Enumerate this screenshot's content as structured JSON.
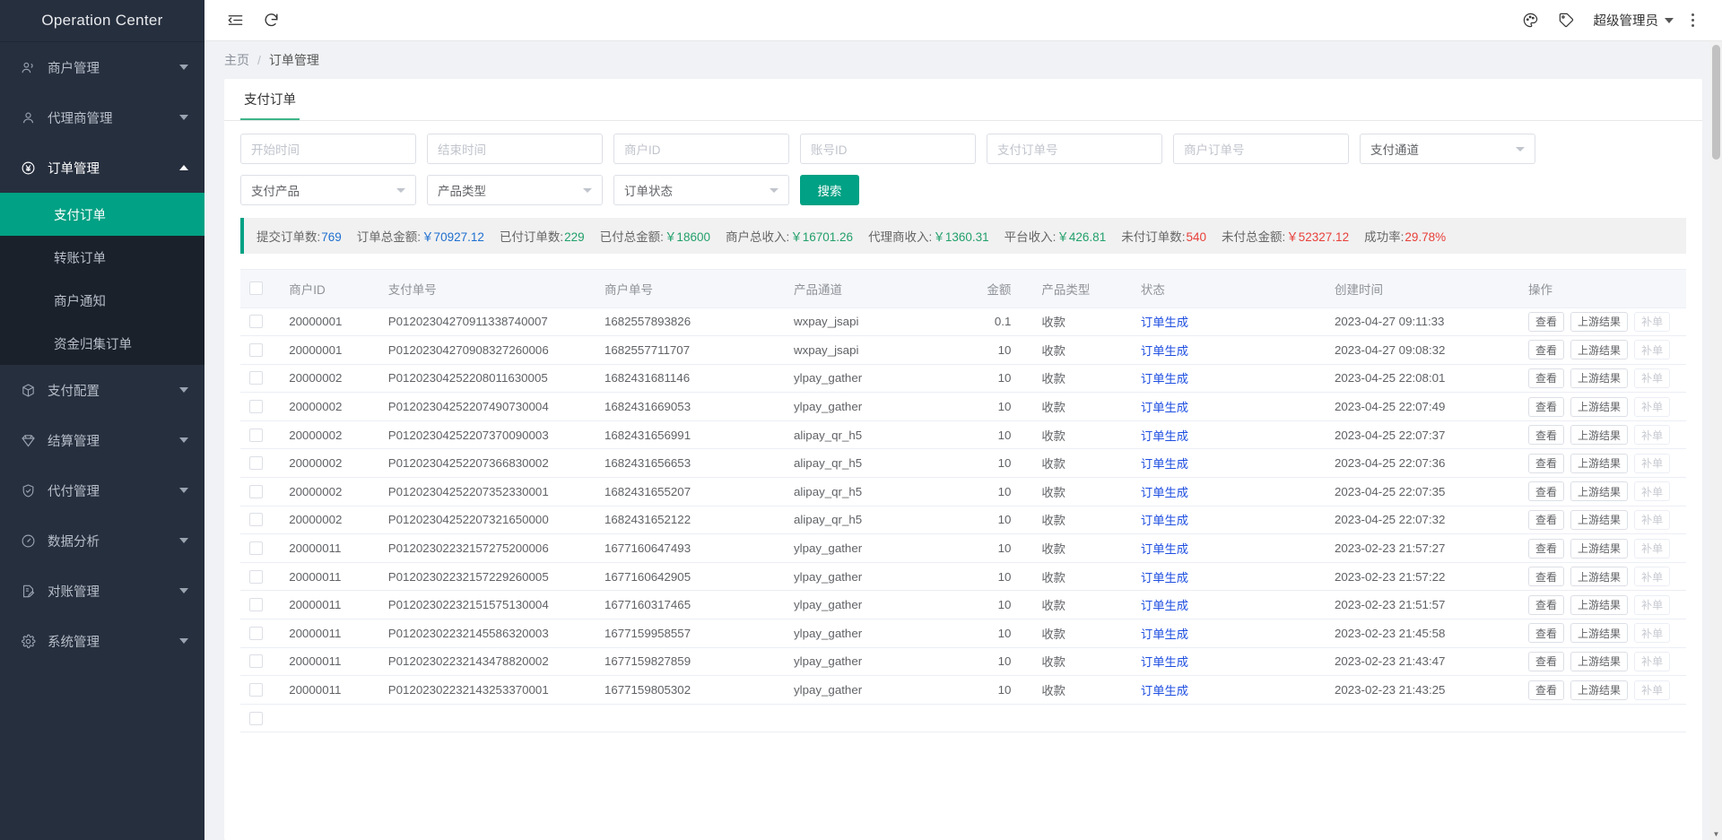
{
  "brand": {
    "title": "Operation Center"
  },
  "sidebar": {
    "groups": [
      {
        "label": "商户管理",
        "icon": "users-icon",
        "open": false,
        "items": []
      },
      {
        "label": "代理商管理",
        "icon": "user-icon",
        "open": false,
        "items": []
      },
      {
        "label": "订单管理",
        "icon": "yen-circle-icon",
        "open": true,
        "items": [
          {
            "label": "支付订单",
            "active": true
          },
          {
            "label": "转账订单",
            "active": false
          },
          {
            "label": "商户通知",
            "active": false
          },
          {
            "label": "资金归集订单",
            "active": false
          }
        ]
      },
      {
        "label": "支付配置",
        "icon": "cube-icon",
        "open": false,
        "items": []
      },
      {
        "label": "结算管理",
        "icon": "diamond-icon",
        "open": false,
        "items": []
      },
      {
        "label": "代付管理",
        "icon": "shield-check-icon",
        "open": false,
        "items": []
      },
      {
        "label": "数据分析",
        "icon": "gauge-icon",
        "open": false,
        "items": []
      },
      {
        "label": "对账管理",
        "icon": "doc-edit-icon",
        "open": false,
        "items": []
      },
      {
        "label": "系统管理",
        "icon": "gear-icon",
        "open": false,
        "items": []
      }
    ]
  },
  "topbar": {
    "collapse_icon": "menu-fold-icon",
    "refresh_icon": "refresh-icon",
    "theme_icon": "palette-icon",
    "tag_icon": "tag-icon",
    "user_name": "超级管理员",
    "more_icon": "more-vertical-icon"
  },
  "breadcrumb": {
    "home": "主页",
    "separator": "/",
    "current": "订单管理"
  },
  "tabs": [
    {
      "label": "支付订单",
      "active": true
    }
  ],
  "filters": {
    "start_time": {
      "placeholder": "开始时间",
      "value": ""
    },
    "end_time": {
      "placeholder": "结束时间",
      "value": ""
    },
    "merchant_id": {
      "placeholder": "商户ID",
      "value": ""
    },
    "account_id": {
      "placeholder": "账号ID",
      "value": ""
    },
    "pay_order_no": {
      "placeholder": "支付订单号",
      "value": ""
    },
    "merchant_order_no": {
      "placeholder": "商户订单号",
      "value": ""
    },
    "pay_channel": {
      "placeholder": "支付通道",
      "value": "支付通道"
    },
    "pay_product": {
      "placeholder": "支付产品",
      "value": "支付产品"
    },
    "product_type": {
      "placeholder": "产品类型",
      "value": "产品类型"
    },
    "order_status": {
      "placeholder": "订单状态",
      "value": "订单状态"
    },
    "search_button": "搜索"
  },
  "stats": [
    {
      "label": "提交订单数:",
      "value": "769",
      "color": "blue"
    },
    {
      "label": "订单总金额:",
      "value": "￥70927.12",
      "color": "blue"
    },
    {
      "label": "已付订单数:",
      "value": "229",
      "color": "green"
    },
    {
      "label": "已付总金额:",
      "value": "￥18600",
      "color": "green"
    },
    {
      "label": "商户总收入:",
      "value": "￥16701.26",
      "color": "green"
    },
    {
      "label": "代理商收入:",
      "value": "￥1360.31",
      "color": "green"
    },
    {
      "label": "平台收入:",
      "value": "￥426.81",
      "color": "green"
    },
    {
      "label": "未付订单数:",
      "value": "540",
      "color": "red"
    },
    {
      "label": "未付总金额:",
      "value": "￥52327.12",
      "color": "red"
    },
    {
      "label": "成功率:",
      "value": "29.78%",
      "color": "red"
    }
  ],
  "table": {
    "columns": [
      "",
      "商户ID",
      "支付单号",
      "商户单号",
      "产品通道",
      "金额",
      "产品类型",
      "状态",
      "创建时间",
      "操作"
    ],
    "ops": {
      "view": "查看",
      "upstream": "上游结果",
      "repair": "补单"
    },
    "rows": [
      {
        "mid": "20000001",
        "payno": "P01202304270911338740007",
        "mchno": "1682557893826",
        "chan": "wxpay_jsapi",
        "amt": "0.1",
        "ptype": "收款",
        "status": "订单生成",
        "time": "2023-04-27 09:11:33"
      },
      {
        "mid": "20000001",
        "payno": "P01202304270908327260006",
        "mchno": "1682557711707",
        "chan": "wxpay_jsapi",
        "amt": "10",
        "ptype": "收款",
        "status": "订单生成",
        "time": "2023-04-27 09:08:32"
      },
      {
        "mid": "20000002",
        "payno": "P01202304252208011630005",
        "mchno": "1682431681146",
        "chan": "ylpay_gather",
        "amt": "10",
        "ptype": "收款",
        "status": "订单生成",
        "time": "2023-04-25 22:08:01"
      },
      {
        "mid": "20000002",
        "payno": "P01202304252207490730004",
        "mchno": "1682431669053",
        "chan": "ylpay_gather",
        "amt": "10",
        "ptype": "收款",
        "status": "订单生成",
        "time": "2023-04-25 22:07:49"
      },
      {
        "mid": "20000002",
        "payno": "P01202304252207370090003",
        "mchno": "1682431656991",
        "chan": "alipay_qr_h5",
        "amt": "10",
        "ptype": "收款",
        "status": "订单生成",
        "time": "2023-04-25 22:07:37"
      },
      {
        "mid": "20000002",
        "payno": "P01202304252207366830002",
        "mchno": "1682431656653",
        "chan": "alipay_qr_h5",
        "amt": "10",
        "ptype": "收款",
        "status": "订单生成",
        "time": "2023-04-25 22:07:36"
      },
      {
        "mid": "20000002",
        "payno": "P01202304252207352330001",
        "mchno": "1682431655207",
        "chan": "alipay_qr_h5",
        "amt": "10",
        "ptype": "收款",
        "status": "订单生成",
        "time": "2023-04-25 22:07:35"
      },
      {
        "mid": "20000002",
        "payno": "P01202304252207321650000",
        "mchno": "1682431652122",
        "chan": "alipay_qr_h5",
        "amt": "10",
        "ptype": "收款",
        "status": "订单生成",
        "time": "2023-04-25 22:07:32"
      },
      {
        "mid": "20000011",
        "payno": "P01202302232157275200006",
        "mchno": "1677160647493",
        "chan": "ylpay_gather",
        "amt": "10",
        "ptype": "收款",
        "status": "订单生成",
        "time": "2023-02-23 21:57:27"
      },
      {
        "mid": "20000011",
        "payno": "P01202302232157229260005",
        "mchno": "1677160642905",
        "chan": "ylpay_gather",
        "amt": "10",
        "ptype": "收款",
        "status": "订单生成",
        "time": "2023-02-23 21:57:22"
      },
      {
        "mid": "20000011",
        "payno": "P01202302232151575130004",
        "mchno": "1677160317465",
        "chan": "ylpay_gather",
        "amt": "10",
        "ptype": "收款",
        "status": "订单生成",
        "time": "2023-02-23 21:51:57"
      },
      {
        "mid": "20000011",
        "payno": "P01202302232145586320003",
        "mchno": "1677159958557",
        "chan": "ylpay_gather",
        "amt": "10",
        "ptype": "收款",
        "status": "订单生成",
        "time": "2023-02-23 21:45:58"
      },
      {
        "mid": "20000011",
        "payno": "P01202302232143478820002",
        "mchno": "1677159827859",
        "chan": "ylpay_gather",
        "amt": "10",
        "ptype": "收款",
        "status": "订单生成",
        "time": "2023-02-23 21:43:47"
      },
      {
        "mid": "20000011",
        "payno": "P01202302232143253370001",
        "mchno": "1677159805302",
        "chan": "ylpay_gather",
        "amt": "10",
        "ptype": "收款",
        "status": "订单生成",
        "time": "2023-02-23 21:43:25"
      },
      {
        "mid": "",
        "payno": "",
        "mchno": "",
        "chan": "",
        "amt": "",
        "ptype": "",
        "status": "",
        "time": ""
      }
    ]
  },
  "colors": {
    "accent": "#00a184",
    "sidebar": "#262f3e",
    "link": "#1f4fe0"
  }
}
